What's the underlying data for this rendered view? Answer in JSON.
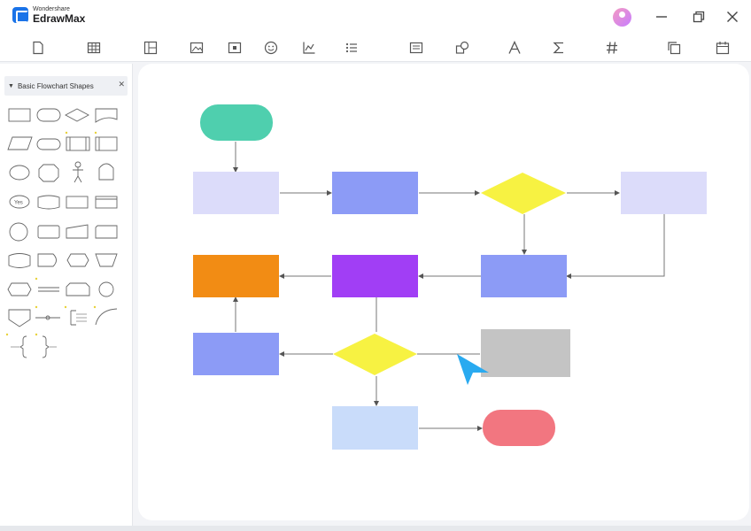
{
  "app": {
    "brand_small": "Wondershare",
    "brand_name": "EdrawMax"
  },
  "window_controls": [
    "minimize-icon",
    "restore-icon",
    "close-icon"
  ],
  "toolbar": {
    "icons": [
      "new-page-icon",
      "table-icon",
      "layout-icon",
      "image-icon",
      "media-icon",
      "emoji-icon",
      "chart-icon",
      "list-icon",
      "text-box-icon",
      "shapes-icon",
      "font-icon",
      "formula-icon",
      "hashtag-icon",
      "pages-icon",
      "calendar-icon"
    ]
  },
  "library": {
    "title": "Basic Flowchart Shapes",
    "yes_label": "Yes"
  },
  "flowchart": {
    "start_color": "#4fcfae",
    "end_color": "#f27680",
    "process_light": "#dcdcfa",
    "process_blue": "#8c9bf6",
    "process_orange": "#f28c14",
    "process_purple": "#a13ef5",
    "process_gray": "#c4c4c4",
    "process_pale": "#c9dcfa",
    "decision_color": "#f7f242"
  },
  "cursor": {
    "color": "#29aaf0"
  }
}
